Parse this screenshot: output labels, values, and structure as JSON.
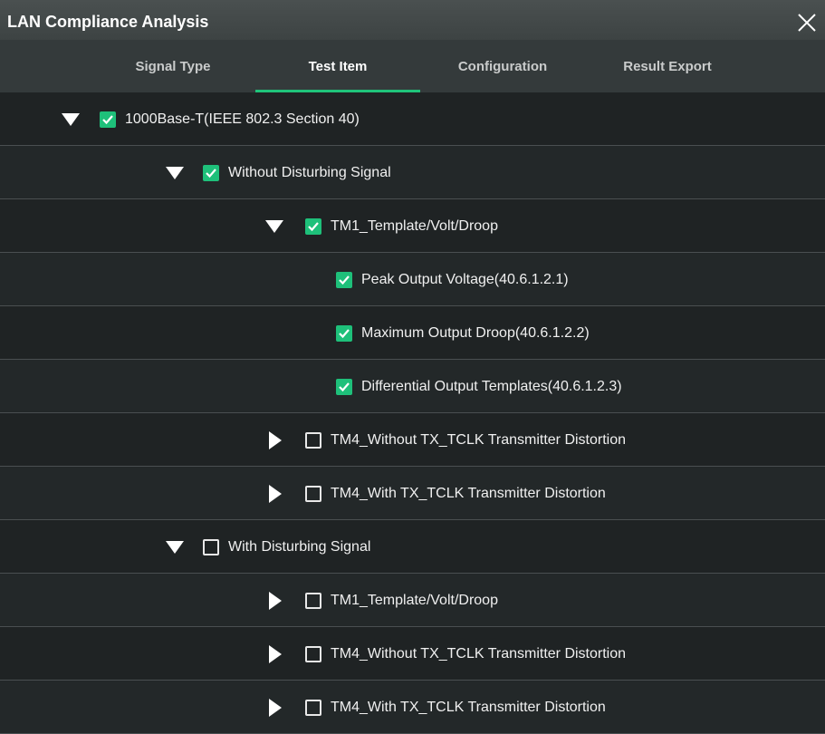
{
  "window": {
    "title": "LAN Compliance Analysis",
    "close_icon": "close-icon"
  },
  "tabs": [
    {
      "label": "Signal Type",
      "active": false
    },
    {
      "label": "Test Item",
      "active": true
    },
    {
      "label": "Configuration",
      "active": false
    },
    {
      "label": "Result Export",
      "active": false
    }
  ],
  "colors": {
    "accent": "#1ec07a",
    "background": "#1f2324",
    "tabbar": "#343a3b",
    "titlebar": "#424848"
  },
  "tree": [
    {
      "label": "1000Base-T(IEEE 802.3 Section 40)",
      "level": 0,
      "expanded": true,
      "checked": true
    },
    {
      "label": "Without Disturbing Signal",
      "level": 1,
      "expanded": true,
      "checked": true
    },
    {
      "label": "TM1_Template/Volt/Droop",
      "level": 2,
      "expanded": true,
      "checked": true
    },
    {
      "label": "Peak Output Voltage(40.6.1.2.1)",
      "level": 3,
      "leaf": true,
      "checked": true
    },
    {
      "label": "Maximum Output Droop(40.6.1.2.2)",
      "level": 3,
      "leaf": true,
      "checked": true
    },
    {
      "label": "Differential Output Templates(40.6.1.2.3)",
      "level": 3,
      "leaf": true,
      "checked": true
    },
    {
      "label": "TM4_Without TX_TCLK Transmitter Distortion",
      "level": 2,
      "expanded": false,
      "checked": false
    },
    {
      "label": "TM4_With TX_TCLK Transmitter Distortion",
      "level": 2,
      "expanded": false,
      "checked": false
    },
    {
      "label": "With Disturbing Signal",
      "level": 1,
      "expanded": true,
      "checked": false
    },
    {
      "label": "TM1_Template/Volt/Droop",
      "level": 2,
      "expanded": false,
      "checked": false
    },
    {
      "label": "TM4_Without TX_TCLK Transmitter Distortion",
      "level": 2,
      "expanded": false,
      "checked": false
    },
    {
      "label": "TM4_With TX_TCLK Transmitter Distortion",
      "level": 2,
      "expanded": false,
      "checked": false
    }
  ]
}
